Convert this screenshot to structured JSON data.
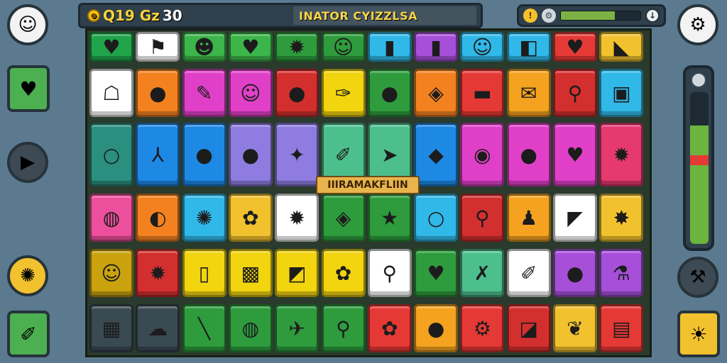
{
  "hud": {
    "coin_glyph": "●",
    "score_label": "Q19 Gz",
    "score_value": "30",
    "title_text": "INATOR CYIZZLSA",
    "energy_fraction": 0.68
  },
  "status": {
    "left_icon": "!",
    "middle_icon": "⚙",
    "clock_icon": "↓"
  },
  "left_buttons": [
    {
      "name": "avatar",
      "glyph": "☺",
      "bg": "#f3f3f3"
    },
    {
      "name": "heart-icon",
      "glyph": "♥",
      "bg": "#4caf50"
    },
    {
      "name": "play-icon",
      "glyph": "▶",
      "bg": "#3d4a53"
    },
    {
      "name": "boost-icon",
      "glyph": "✺",
      "bg": "#f2c12e"
    },
    {
      "name": "sword-icon",
      "glyph": "✐",
      "bg": "#4caf50"
    }
  ],
  "right_buttons": [
    {
      "name": "gear-icon",
      "glyph": "⚙",
      "bg": "#f3f3f3"
    },
    {
      "name": "hammer-icon",
      "glyph": "⚒",
      "bg": "#3d4a53"
    },
    {
      "name": "sun-icon",
      "glyph": "☀",
      "bg": "#f2c12e"
    }
  ],
  "vertical_meter": {
    "fill_fraction": 0.78,
    "marker_fraction": 0.52
  },
  "board": {
    "banner_text": "IIIRAMAKFLIIN",
    "rows": [
      [
        {
          "c": "#1fa44a",
          "g": "♥"
        },
        {
          "c": "#ffffff",
          "g": "⚑"
        },
        {
          "c": "#3cb54a",
          "g": "☻"
        },
        {
          "c": "#3cb54a",
          "g": "♥"
        },
        {
          "c": "#2e9b3d",
          "g": "✹"
        },
        {
          "c": "#2e9b3d",
          "g": "☺"
        },
        {
          "c": "#30b8e8",
          "g": "▮"
        },
        {
          "c": "#a64fd9",
          "g": "▮"
        },
        {
          "c": "#30b8e8",
          "g": "☺"
        },
        {
          "c": "#30b8e8",
          "g": "◧"
        },
        {
          "c": "#e53935",
          "g": "♥"
        },
        {
          "c": "#f2c12e",
          "g": "◣"
        }
      ],
      [
        {
          "c": "#ffffff",
          "g": "☖"
        },
        {
          "c": "#f4811f",
          "g": "●"
        },
        {
          "c": "#e040c8",
          "g": "✎"
        },
        {
          "c": "#e040c8",
          "g": "☺"
        },
        {
          "c": "#d32f2f",
          "g": "●"
        },
        {
          "c": "#f2d40f",
          "g": "✑"
        },
        {
          "c": "#2e9b3d",
          "g": "●"
        },
        {
          "c": "#f4811f",
          "g": "◈"
        },
        {
          "c": "#e53935",
          "g": "▬"
        },
        {
          "c": "#f4a21f",
          "g": "✉"
        },
        {
          "c": "#d32f2f",
          "g": "⚲"
        },
        {
          "c": "#30b8e8",
          "g": "▣"
        }
      ],
      [
        {
          "c": "#2a8f7e",
          "g": "○"
        },
        {
          "c": "#1e88e5",
          "g": "⅄"
        },
        {
          "c": "#1e88e5",
          "g": "●"
        },
        {
          "c": "#8e7ce0",
          "g": "●"
        },
        {
          "c": "#8e7ce0",
          "g": "✦"
        },
        {
          "c": "#4cbf8c",
          "g": "✐"
        },
        {
          "c": "#4cbf8c",
          "g": "➤"
        },
        {
          "c": "#1e88e5",
          "g": "◆"
        },
        {
          "c": "#e040c8",
          "g": "◉"
        },
        {
          "c": "#e040c8",
          "g": "●"
        },
        {
          "c": "#e040c8",
          "g": "♥"
        },
        {
          "c": "#e53970",
          "g": "✹"
        }
      ],
      [
        {
          "c": "#ec4f9c",
          "g": "◍"
        },
        {
          "c": "#f4811f",
          "g": "◐"
        },
        {
          "c": "#30b8e8",
          "g": "✺"
        },
        {
          "c": "#f2c12e",
          "g": "✿"
        },
        {
          "c": "#ffffff",
          "g": "✹"
        },
        {
          "c": "#2e9b3d",
          "g": "◈"
        },
        {
          "c": "#2e9b3d",
          "g": "★"
        },
        {
          "c": "#30b8e8",
          "g": "○"
        },
        {
          "c": "#d32f2f",
          "g": "⚲"
        },
        {
          "c": "#f4a21f",
          "g": "♟"
        },
        {
          "c": "#ffffff",
          "g": "◤"
        },
        {
          "c": "#f2c12e",
          "g": "✸"
        }
      ],
      [
        {
          "c": "#c9a20e",
          "g": "☺"
        },
        {
          "c": "#d32f2f",
          "g": "✹"
        },
        {
          "c": "#f2d40f",
          "g": "▯"
        },
        {
          "c": "#f2d40f",
          "g": "▩"
        },
        {
          "c": "#f2d40f",
          "g": "◩"
        },
        {
          "c": "#f2d40f",
          "g": "✿"
        },
        {
          "c": "#ffffff",
          "g": "⚲"
        },
        {
          "c": "#2e9b3d",
          "g": "♥"
        },
        {
          "c": "#4cbf8c",
          "g": "✗"
        },
        {
          "c": "#ffffff",
          "g": "✐"
        },
        {
          "c": "#a64fd9",
          "g": "●"
        },
        {
          "c": "#a64fd9",
          "g": "⚗"
        }
      ],
      [
        {
          "c": "#3a4a52",
          "g": "▦"
        },
        {
          "c": "#3a4a52",
          "g": "☁"
        },
        {
          "c": "#2e9b3d",
          "g": "╲"
        },
        {
          "c": "#2e9b3d",
          "g": "◍"
        },
        {
          "c": "#2e9b3d",
          "g": "✈"
        },
        {
          "c": "#2e9b3d",
          "g": "⚲"
        },
        {
          "c": "#e53935",
          "g": "✿"
        },
        {
          "c": "#f4a21f",
          "g": "●"
        },
        {
          "c": "#e53935",
          "g": "⚙"
        },
        {
          "c": "#d32f2f",
          "g": "◪"
        },
        {
          "c": "#f2c12e",
          "g": "❦"
        },
        {
          "c": "#e53935",
          "g": "▤"
        }
      ]
    ]
  }
}
